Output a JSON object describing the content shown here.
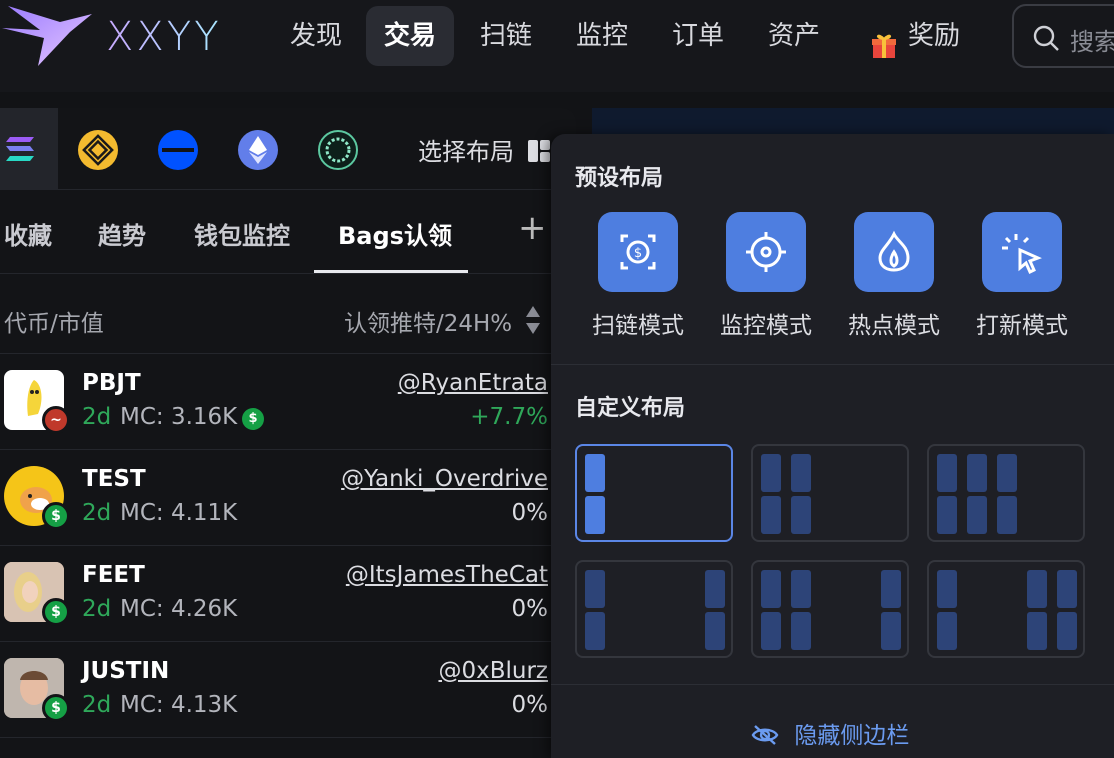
{
  "brand": {
    "name": "XXYY"
  },
  "nav": {
    "items": [
      "发现",
      "交易",
      "扫链",
      "监控",
      "订单",
      "资产",
      "奖励"
    ],
    "active": "交易"
  },
  "search": {
    "placeholder": "搜索"
  },
  "chains": {
    "icons": [
      "solana-icon",
      "bnb-icon",
      "base-icon",
      "ethereum-icon",
      "chain-icon"
    ],
    "layout_label": "选择布局"
  },
  "tabs": {
    "items": [
      "收藏",
      "趋势",
      "钱包监控",
      "Bags认领"
    ],
    "active": "Bags认领"
  },
  "table": {
    "col_left": "代币/市值",
    "col_right": "认领推特/24H%",
    "rows": [
      {
        "symbol": "PBJT",
        "age": "2d",
        "mc": "MC: 3.16K",
        "handle": "@RyanEtrata",
        "pct": "+7.7%",
        "positive": true
      },
      {
        "symbol": "TEST",
        "age": "2d",
        "mc": "MC: 4.11K",
        "handle": "@Yanki_Overdrive",
        "pct": "0%",
        "positive": false
      },
      {
        "symbol": "FEET",
        "age": "2d",
        "mc": "MC: 4.26K",
        "handle": "@ItsJamesTheCat",
        "pct": "0%",
        "positive": false
      },
      {
        "symbol": "JUSTIN",
        "age": "2d",
        "mc": "MC: 4.13K",
        "handle": "@0xBlurz",
        "pct": "0%",
        "positive": false
      }
    ]
  },
  "popup": {
    "preset_title": "预设布局",
    "presets": [
      "扫链模式",
      "监控模式",
      "热点模式",
      "打新模式"
    ],
    "custom_title": "自定义布局",
    "hide_label": "隐藏侧边栏"
  },
  "colors": {
    "accent": "#4e7ee0",
    "positive": "#2fa85a",
    "bg": "#121316"
  }
}
